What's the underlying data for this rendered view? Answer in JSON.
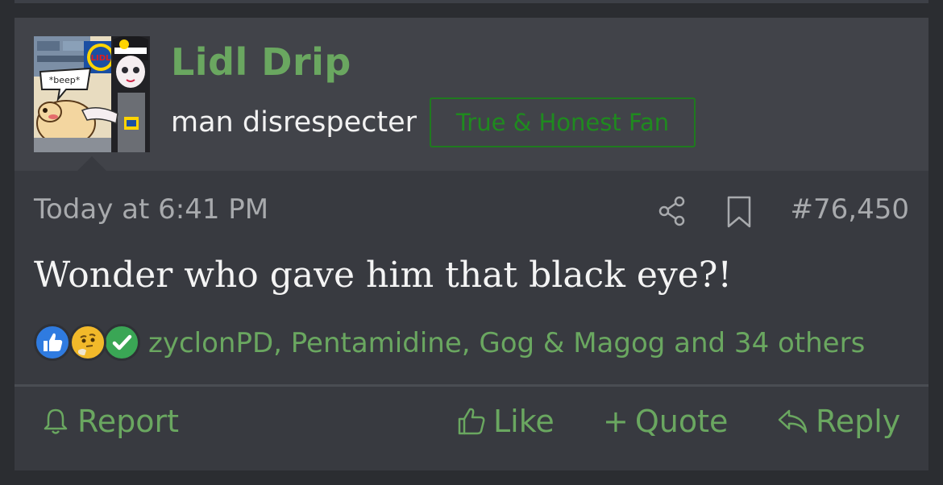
{
  "post": {
    "author": {
      "username": "Lidl Drip",
      "user_title": "man disrespecter",
      "badge": "True & Honest Fan",
      "avatar_text": "*beep*",
      "avatar_logo_text": "LIDL"
    },
    "timestamp": "Today at 6:41 PM",
    "post_number": "#76,450",
    "message": "Wonder who gave him that black eye?!",
    "reactions": {
      "icons": [
        "thumbs-up-icon",
        "thinking-face-icon",
        "checkmark-icon"
      ],
      "summary": "zyclonPD, Pentamidine, Gog & Magog and 34 others"
    },
    "actions": {
      "report": "Report",
      "like": "Like",
      "quote": "Quote",
      "quote_prefix": "+",
      "reply": "Reply"
    }
  },
  "colors": {
    "accent_green": "#6aa760",
    "badge_green": "#1f7a1f",
    "post_background": "#383a40",
    "header_background": "#414349",
    "page_background": "#2b2d31"
  }
}
